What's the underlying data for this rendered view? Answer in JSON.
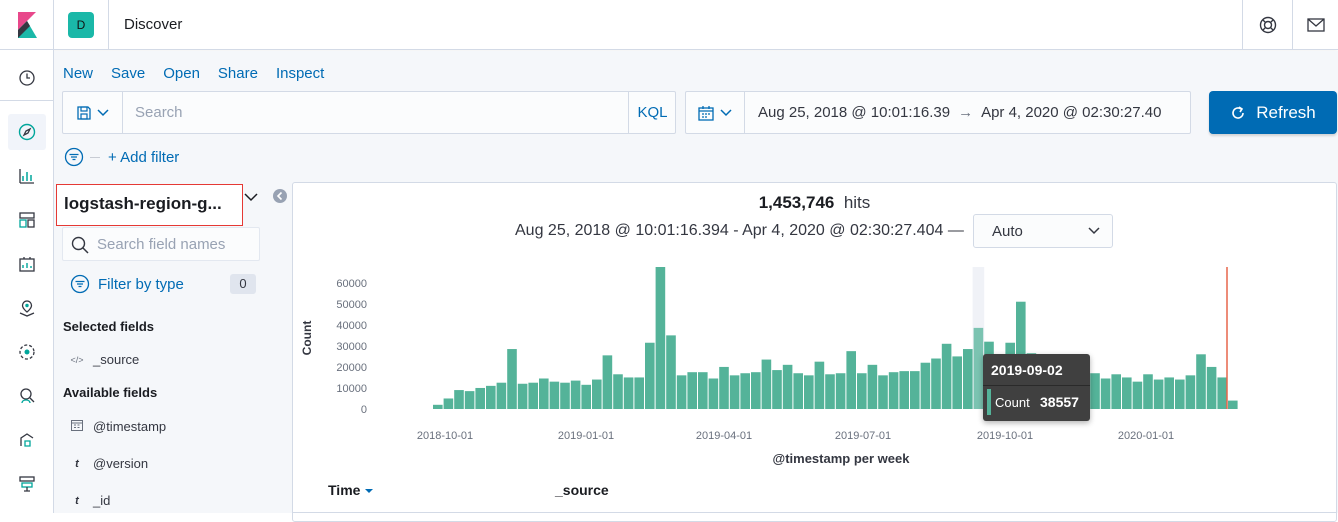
{
  "header": {
    "space_initial": "D",
    "title": "Discover",
    "icons": [
      "help-icon",
      "mail-icon"
    ]
  },
  "nav": {
    "items": [
      "clock-icon",
      "compass-icon",
      "visualize-icon",
      "dashboard-icon",
      "canvas-icon",
      "maps-icon",
      "ml-icon",
      "siem-icon",
      "logs-icon",
      "infra-icon"
    ],
    "active": "compass-icon"
  },
  "toolbar": {
    "new": "New",
    "save": "Save",
    "open": "Open",
    "share": "Share",
    "inspect": "Inspect"
  },
  "query": {
    "placeholder": "Search",
    "language": "KQL"
  },
  "time": {
    "start": "Aug 25, 2018 @ 10:01:16.39",
    "arrow": "→",
    "end": "Apr 4, 2020 @ 02:30:27.40"
  },
  "refresh_label": "Refresh",
  "filters": {
    "add_label": "+ Add filter"
  },
  "sidebar": {
    "index_pattern": "logstash-region-g...",
    "search_placeholder": "Search field names",
    "filter_by_type": "Filter by type",
    "filter_count": "0",
    "selected_title": "Selected fields",
    "available_title": "Available fields",
    "selected_fields": [
      {
        "type_icon": "</>",
        "name": "_source"
      }
    ],
    "available_fields": [
      {
        "type_icon": "cal",
        "name": "@timestamp"
      },
      {
        "type_icon": "t",
        "name": "@version"
      },
      {
        "type_icon": "t",
        "name": "_id"
      }
    ]
  },
  "histogram": {
    "hits_count": "1,453,746",
    "hits_label": "hits",
    "range_text": "Aug 25, 2018 @ 10:01:16.394 - Apr 4, 2020 @ 02:30:27.404 —",
    "interval": "Auto",
    "tooltip": {
      "date": "2019-09-02",
      "label": "Count",
      "value": "38557"
    }
  },
  "chart_data": {
    "type": "bar",
    "xlabel": "@timestamp per week",
    "ylabel": "Count",
    "ylim": [
      0,
      67500
    ],
    "yticks": [
      0,
      10000,
      20000,
      30000,
      40000,
      50000,
      60000
    ],
    "xticks": [
      "2018-10-01",
      "2019-01-01",
      "2019-04-01",
      "2019-07-01",
      "2019-10-01",
      "2020-01-01"
    ],
    "bar_color": "#54b399",
    "values": [
      2000,
      5000,
      9000,
      8500,
      10000,
      11000,
      12500,
      28500,
      12000,
      12500,
      14500,
      13000,
      12500,
      13500,
      11500,
      14000,
      25500,
      16500,
      15000,
      15000,
      31500,
      67500,
      35000,
      16000,
      17500,
      17500,
      14500,
      20000,
      16000,
      17000,
      17500,
      23500,
      18500,
      21000,
      17000,
      16000,
      22500,
      16500,
      17000,
      27500,
      17000,
      21000,
      16000,
      17500,
      18000,
      18000,
      22000,
      24000,
      31000,
      25000,
      28500,
      38557,
      32000,
      19000,
      31500,
      51000,
      26500,
      21000,
      13000,
      16500,
      16000,
      17000,
      17000,
      14500,
      16500,
      15000,
      13000,
      16500,
      14000,
      15000,
      14000,
      16000,
      26000,
      20000,
      15000,
      4000
    ],
    "highlight_index": 51,
    "marker": "now"
  },
  "table": {
    "col_time": "Time",
    "col_source": "_source"
  }
}
